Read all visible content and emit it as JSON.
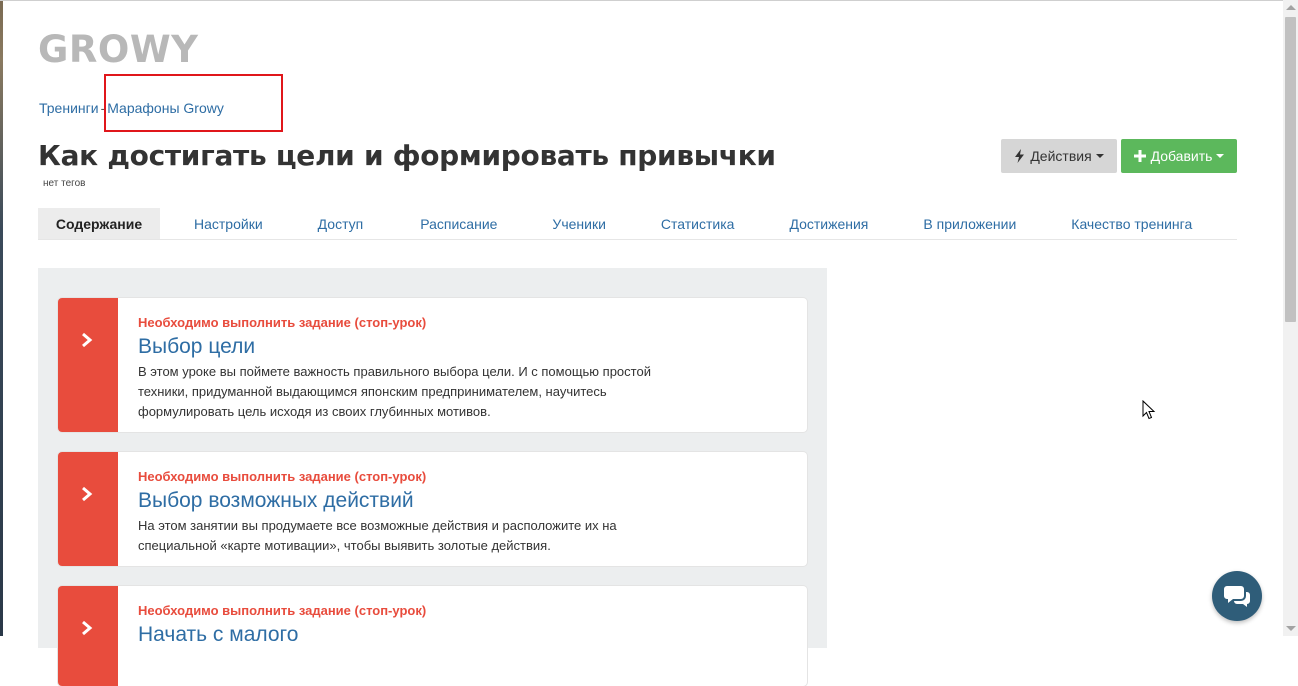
{
  "logo": "GROWY",
  "breadcrumb": {
    "root": "Тренинги",
    "separator": "-",
    "current": "Марафоны Growy"
  },
  "page_title": "Как достигать цели и формировать привычки",
  "tags": "нет тегов",
  "buttons": {
    "actions": "Действия",
    "add": "Добавить"
  },
  "tabs": [
    "Содержание",
    "Настройки",
    "Доступ",
    "Расписание",
    "Ученики",
    "Статистика",
    "Достижения",
    "В приложении",
    "Качество тренинга"
  ],
  "lessons": [
    {
      "stop": "Необходимо выполнить задание (стоп-урок)",
      "title": "Выбор цели",
      "description": "В этом уроке вы поймете важность правильного выбора цели. И с помощью простой техники, придуманной выдающимся японским предпринимателем, научитесь формулировать цель исходя из своих глубинных мотивов."
    },
    {
      "stop": "Необходимо выполнить задание (стоп-урок)",
      "title": "Выбор возможных действий",
      "description": "На этом занятии вы продумаете все возможные действия и расположите их на специальной «карте мотивации», чтобы выявить золотые действия."
    },
    {
      "stop": "Необходимо выполнить задание (стоп-урок)",
      "title": "Начать с малого",
      "description": ""
    }
  ],
  "icons": {
    "actions": "bolt-icon",
    "add": "plus-icon",
    "lesson": "chevron-right-icon",
    "chat": "chat-bubbles-icon"
  },
  "colors": {
    "link": "#2e6da4",
    "stop": "#e84c3d",
    "add_button": "#5cb85c",
    "chat": "#2f5d79",
    "highlight": "#e0161b"
  }
}
